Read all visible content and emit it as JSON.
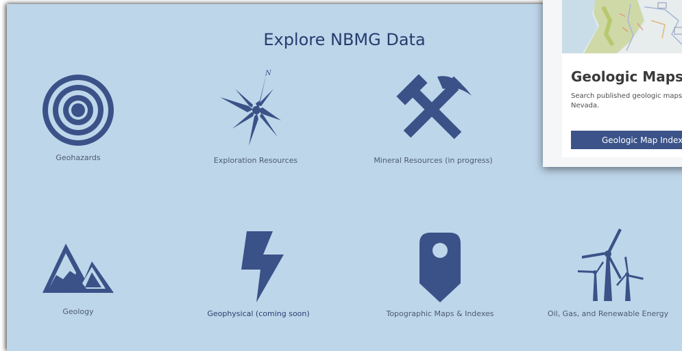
{
  "page_title": "Explore NBMG Data",
  "tiles": [
    {
      "label": "Geohazards",
      "icon": "target-icon"
    },
    {
      "label": "Exploration Resources",
      "icon": "compass-rose-icon"
    },
    {
      "label": "Mineral Resources (in progress)",
      "icon": "pickaxe-hammer-icon"
    },
    {
      "label": "Geology",
      "icon": "mountains-icon"
    },
    {
      "label": "Geophysical (coming soon)",
      "icon": "lightning-bolt-icon"
    },
    {
      "label": "Topographic Maps & Indexes",
      "icon": "map-pin-icon"
    },
    {
      "label": "Oil, Gas, and Renewable Energy",
      "icon": "wind-turbines-icon"
    }
  ],
  "popup": {
    "title": "Geologic Maps",
    "description": "Search published geologic maps of Nevada.",
    "button_label": "Geologic Map Index"
  },
  "colors": {
    "background": "#bed6ea",
    "icon": "#3a5287",
    "title": "#263d6e",
    "button": "#3b5388"
  }
}
